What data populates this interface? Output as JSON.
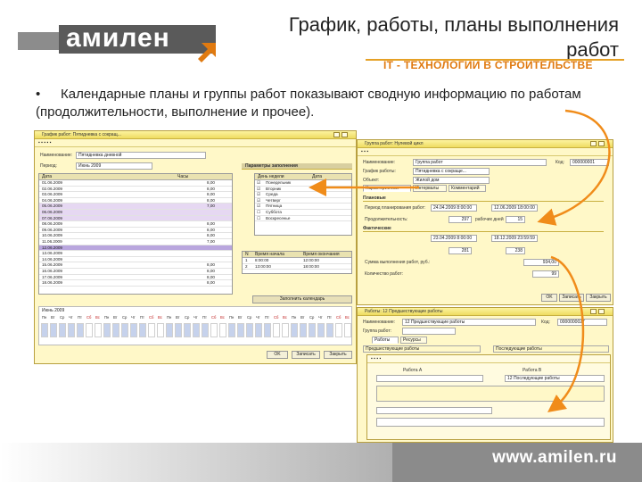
{
  "header": {
    "logo_text": "амилен",
    "title_line1": "График, работы, планы выполнения",
    "title_line2": "работ",
    "subtitle": "IT - ТЕХНОЛОГИИ В СТРОИТЕЛЬСТВЕ"
  },
  "bullet": {
    "marker": "•",
    "text": "Календарные планы и группы работ показывают сводную информацию по работам (продолжительности, выполнение и прочее)."
  },
  "footer": {
    "url": "www.amilen.ru"
  },
  "colors": {
    "accent": "#e07a10",
    "window_bg": "#fff8c8",
    "row_highlight": "#e6d8f2",
    "arrow": "#f08c1a",
    "footer": "#8b8b8b"
  },
  "win_left": {
    "title": "График работ: Пятидневка с сокращ...",
    "name_label": "Наименование:",
    "name_value": "Пятидневка дневной",
    "period_label": "Период:",
    "period_value": "Июнь 2009",
    "params_label": "Параметры заполнения",
    "columns": [
      "Дата",
      "Часы"
    ],
    "rows": [
      {
        "date": "01.06.2009",
        "hours": "8,00"
      },
      {
        "date": "02.06.2009",
        "hours": "8,00"
      },
      {
        "date": "03.06.2009",
        "hours": "8,00"
      },
      {
        "date": "04.06.2009",
        "hours": "8,00"
      },
      {
        "date": "05.06.2009",
        "hours": "7,00"
      },
      {
        "date": "06.06.2009",
        "hours": ""
      },
      {
        "date": "07.06.2009",
        "hours": ""
      },
      {
        "date": "08.06.2009",
        "hours": "8,00"
      },
      {
        "date": "09.06.2009",
        "hours": "8,00"
      },
      {
        "date": "10.06.2009",
        "hours": "8,00"
      },
      {
        "date": "11.06.2009",
        "hours": "7,00"
      },
      {
        "date": "12.06.2009",
        "hours": ""
      },
      {
        "date": "13.06.2009",
        "hours": ""
      },
      {
        "date": "14.06.2009",
        "hours": ""
      },
      {
        "date": "15.06.2009",
        "hours": "8,00"
      },
      {
        "date": "16.06.2009",
        "hours": "8,00"
      },
      {
        "date": "17.06.2009",
        "hours": "8,00"
      },
      {
        "date": "18.06.2009",
        "hours": "8,00"
      }
    ],
    "weekday_grid": {
      "columns": [
        "День недели",
        "Дата"
      ],
      "rows": [
        "Понедельник",
        "Вторник",
        "Среда",
        "Четверг",
        "Пятница",
        "Суббота",
        "Воскресенье"
      ]
    },
    "time_grid": {
      "columns": [
        "N",
        "Время начала",
        "Время окончания"
      ],
      "rows": [
        [
          "1",
          "8:00:00",
          "12:00:00"
        ],
        [
          "2",
          "13:00:00",
          "18:00:00"
        ]
      ]
    },
    "fill_button": "Заполнить календарь",
    "calendar_title": "Июнь 2009",
    "weekday_short": [
      "Пн",
      "Вт",
      "Ср",
      "Чт",
      "Пт",
      "Сб",
      "Вс"
    ],
    "ok_label": "OK",
    "write_label": "Записать",
    "close_label": "Закрыть"
  },
  "win_top_right": {
    "title": "Группа работ: Нулевой цикл",
    "name_label": "Наименование:",
    "name_value": "Группа работ",
    "code_label": "Код:",
    "code_value": "000000001",
    "schedule_label": "График работы:",
    "schedule_value": "Пятидневка с сокраще...",
    "object_label": "Объект:",
    "object_value": "Жилой дом",
    "tabs": [
      "Характеристики",
      "Интервалы",
      "Комментарий"
    ],
    "planned_section": "Плановые",
    "planned_start_label": "Период планирования работ:",
    "planned_start": "24.04.2009 8:00:00",
    "planned_end": "12.06.2009 18:00:00",
    "duration_label": "Продолжительность:",
    "duration_value": "297",
    "duration_unit": "рабочих дней",
    "duration_value2": "15",
    "factual_section": "Фактические",
    "factual_start": "23.04.2009 8:00:00",
    "factual_end": "18.12.2009 23:59:59",
    "factual_duration": "281",
    "factual_duration2": "238",
    "completion_label": "Сумма выполнения работ, руб.:",
    "completion_value": "934,00",
    "count_label": "Количество работ:",
    "count_value": "99",
    "ok_label": "OK",
    "write_label": "Записать",
    "close_label": "Закрыть"
  },
  "win_bottom_right": {
    "title": "Работы: 12 Предшествующие работы",
    "name_label": "Наименование:",
    "name_value": "12 Предшествующие работы",
    "code_label": "Код:",
    "code_value": "0000000027",
    "group_label": "Группа работ:",
    "tabs": [
      "Работы",
      "Ресурсы"
    ],
    "col_a": "Предшествующие работы",
    "col_b": "Последующие работы",
    "work_a_label": "Работа A",
    "work_b_label": "Работа B",
    "work_b_value": "12 Последующие работы",
    "ok_label": "OK",
    "write_label": "Записать",
    "close_label": "Закрыть"
  }
}
